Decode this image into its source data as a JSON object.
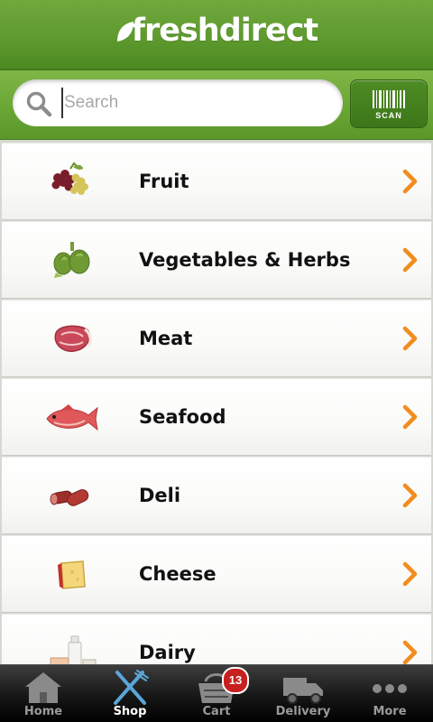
{
  "app": {
    "logo_text": "freshdirect",
    "accent": "#5e9a2e",
    "chevron_color": "#f28c1e"
  },
  "search": {
    "placeholder": "Search",
    "value": "",
    "scan_label": "SCAN"
  },
  "categories": [
    {
      "label": "Fruit",
      "icon": "grapes-icon"
    },
    {
      "label": "Vegetables & Herbs",
      "icon": "artichoke-icon"
    },
    {
      "label": "Meat",
      "icon": "steak-icon"
    },
    {
      "label": "Seafood",
      "icon": "fish-icon"
    },
    {
      "label": "Deli",
      "icon": "salami-icon"
    },
    {
      "label": "Cheese",
      "icon": "cheese-icon"
    },
    {
      "label": "Dairy",
      "icon": "milk-icon"
    }
  ],
  "tabs": [
    {
      "label": "Home",
      "icon": "house-icon"
    },
    {
      "label": "Shop",
      "icon": "fork-knife-icon",
      "active": true
    },
    {
      "label": "Cart",
      "icon": "basket-icon",
      "badge": "13"
    },
    {
      "label": "Delivery",
      "icon": "truck-icon"
    },
    {
      "label": "More",
      "icon": "ellipsis-icon"
    }
  ]
}
